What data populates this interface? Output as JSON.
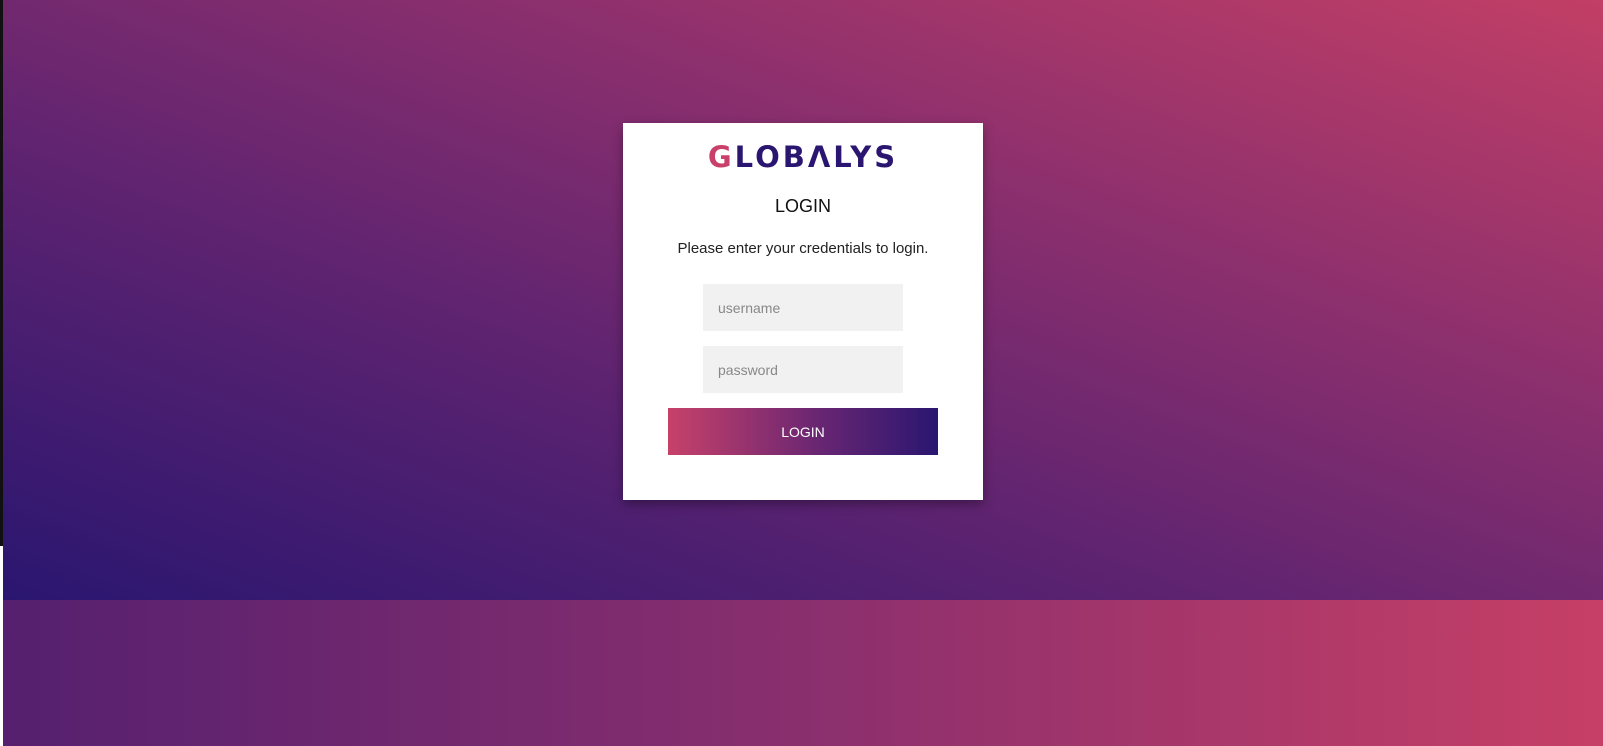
{
  "brand": {
    "logo_first": "G",
    "logo_rest": "LOBΛLYS",
    "logo_accent_color": "#c9416b",
    "logo_color": "#2a1670"
  },
  "login": {
    "title": "LOGIN",
    "subtitle": "Please enter your credentials to login.",
    "username_placeholder": "username",
    "password_placeholder": "password",
    "button_label": "LOGIN"
  },
  "colors": {
    "gradient_dark": "#2a1670",
    "gradient_pink": "#c23f66"
  }
}
